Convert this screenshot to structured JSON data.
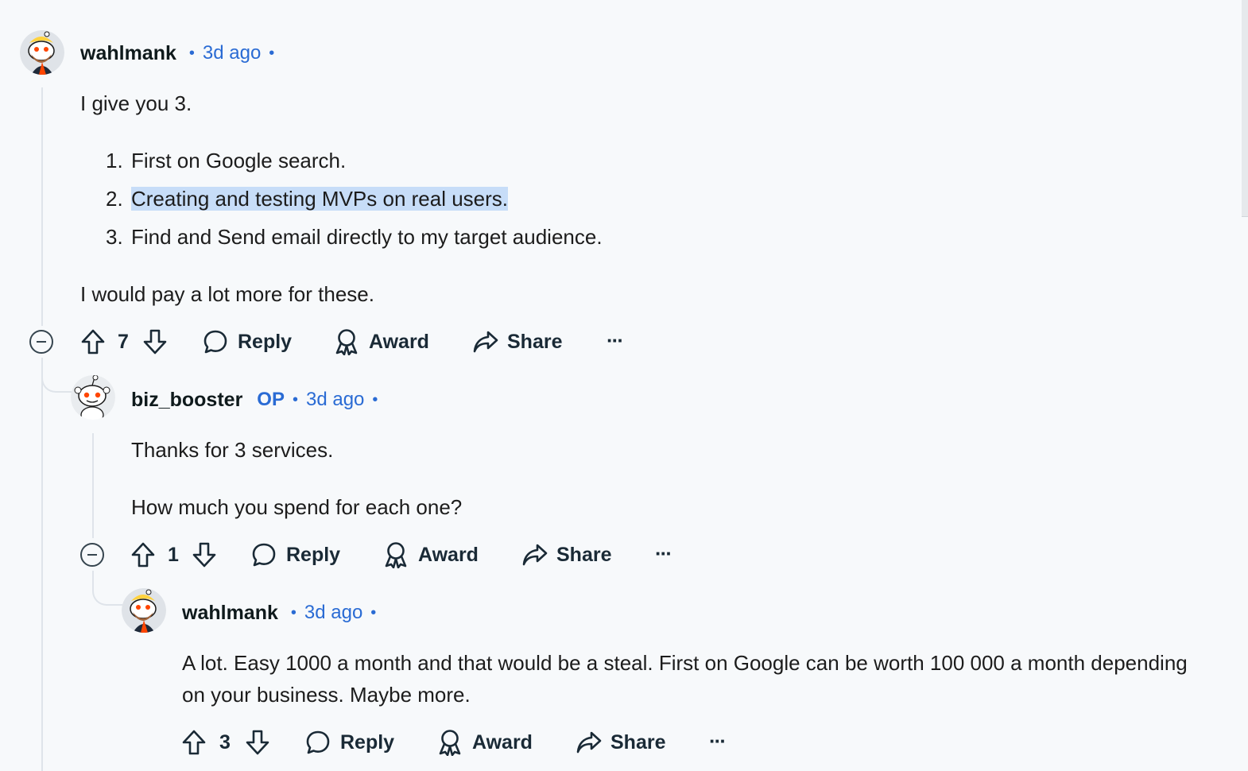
{
  "comments": [
    {
      "author": "wahlmank",
      "time": "3d ago",
      "paragraphs": [
        "I give you 3.",
        "I would pay a lot more for these."
      ],
      "list": [
        {
          "num": "1.",
          "text": "First on Google search."
        },
        {
          "num": "2.",
          "text": "Creating and testing MVPs on real users."
        },
        {
          "num": "3.",
          "text": "Find and Send email directly to my target audience."
        }
      ],
      "votes": "7"
    },
    {
      "author": "biz_booster",
      "op_label": "OP",
      "time": "3d ago",
      "paragraphs": [
        "Thanks for 3 services.",
        "How much you spend for each one?"
      ],
      "votes": "1"
    },
    {
      "author": "wahlmank",
      "time": "3d ago",
      "paragraphs": [
        "A lot. Easy 1000 a month and that would be a steal. First on Google can be worth 100 000 a month depending on your business. Maybe more."
      ],
      "votes": "3"
    }
  ],
  "actions": {
    "reply": "Reply",
    "award": "Award",
    "share": "Share",
    "more": "···",
    "separator": "•"
  },
  "icons": {
    "upvote": "upvote-arrow-icon",
    "downvote": "downvote-arrow-icon",
    "reply": "speech-bubble-icon",
    "award": "award-ribbon-icon",
    "share": "share-arrow-icon",
    "collapse": "minus-circle-icon"
  },
  "colors": {
    "background": "#f7f9fb",
    "accent": "#2a6bd4",
    "highlight": "#c7ddf8",
    "thread_line": "#dfe4ea"
  }
}
